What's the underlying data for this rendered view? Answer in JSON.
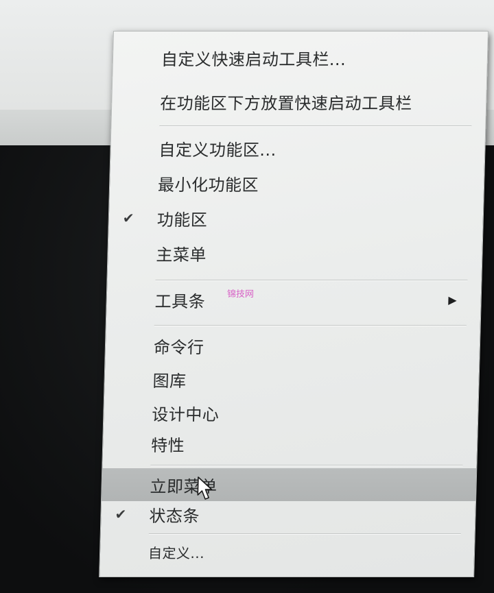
{
  "menu": {
    "items": [
      {
        "label": "自定义快速启动工具栏...",
        "checked": false,
        "submenu": false
      },
      {
        "label": "在功能区下方放置快速启动工具栏",
        "checked": false,
        "submenu": false
      },
      {
        "label": "自定义功能区...",
        "checked": false,
        "submenu": false
      },
      {
        "label": "最小化功能区",
        "checked": false,
        "submenu": false
      },
      {
        "label": "功能区",
        "checked": true,
        "submenu": false
      },
      {
        "label": "主菜单",
        "checked": false,
        "submenu": false
      },
      {
        "label": "工具条",
        "checked": false,
        "submenu": true
      },
      {
        "label": "命令行",
        "checked": false,
        "submenu": false
      },
      {
        "label": "图库",
        "checked": false,
        "submenu": false
      },
      {
        "label": "设计中心",
        "checked": false,
        "submenu": false
      },
      {
        "label": "特性",
        "checked": false,
        "submenu": false
      },
      {
        "label": "立即菜单",
        "checked": false,
        "submenu": false,
        "highlighted": true
      },
      {
        "label": "状态条",
        "checked": true,
        "submenu": false
      },
      {
        "label": "自定义...",
        "checked": false,
        "submenu": false
      }
    ],
    "check_glyph": "✔",
    "submenu_glyph": "▶"
  },
  "watermark": "锦技网",
  "colors": {
    "menu_bg": "#eceeed",
    "highlight_bg": "#b5b8b8",
    "text": "#2a2c2d",
    "watermark": "#d860c6"
  }
}
